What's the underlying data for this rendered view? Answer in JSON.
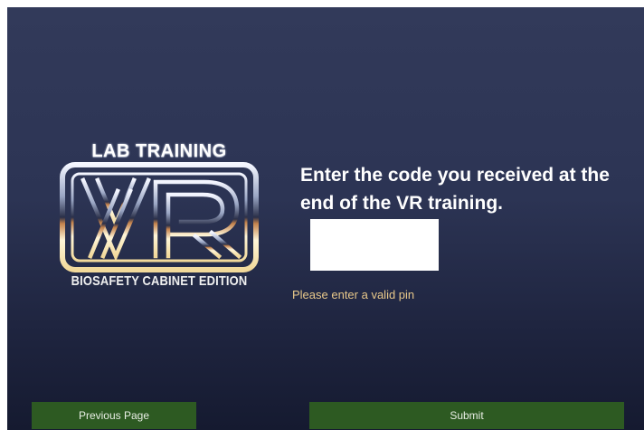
{
  "logo": {
    "title": "LAB TRAINING",
    "subtitle": "BIOSAFETY CABINET EDITION"
  },
  "prompt": {
    "text": "Enter the code you received at the end of the VR training."
  },
  "pin": {
    "value": "",
    "placeholder": ""
  },
  "error": {
    "text": "Please enter a valid pin"
  },
  "buttons": {
    "previous_label": "Previous Page",
    "submit_label": "Submit"
  },
  "colors": {
    "background_top": "#323a5a",
    "background_bottom": "#151a30",
    "button_green": "#2d5a22",
    "error_text": "#e8c88a"
  }
}
